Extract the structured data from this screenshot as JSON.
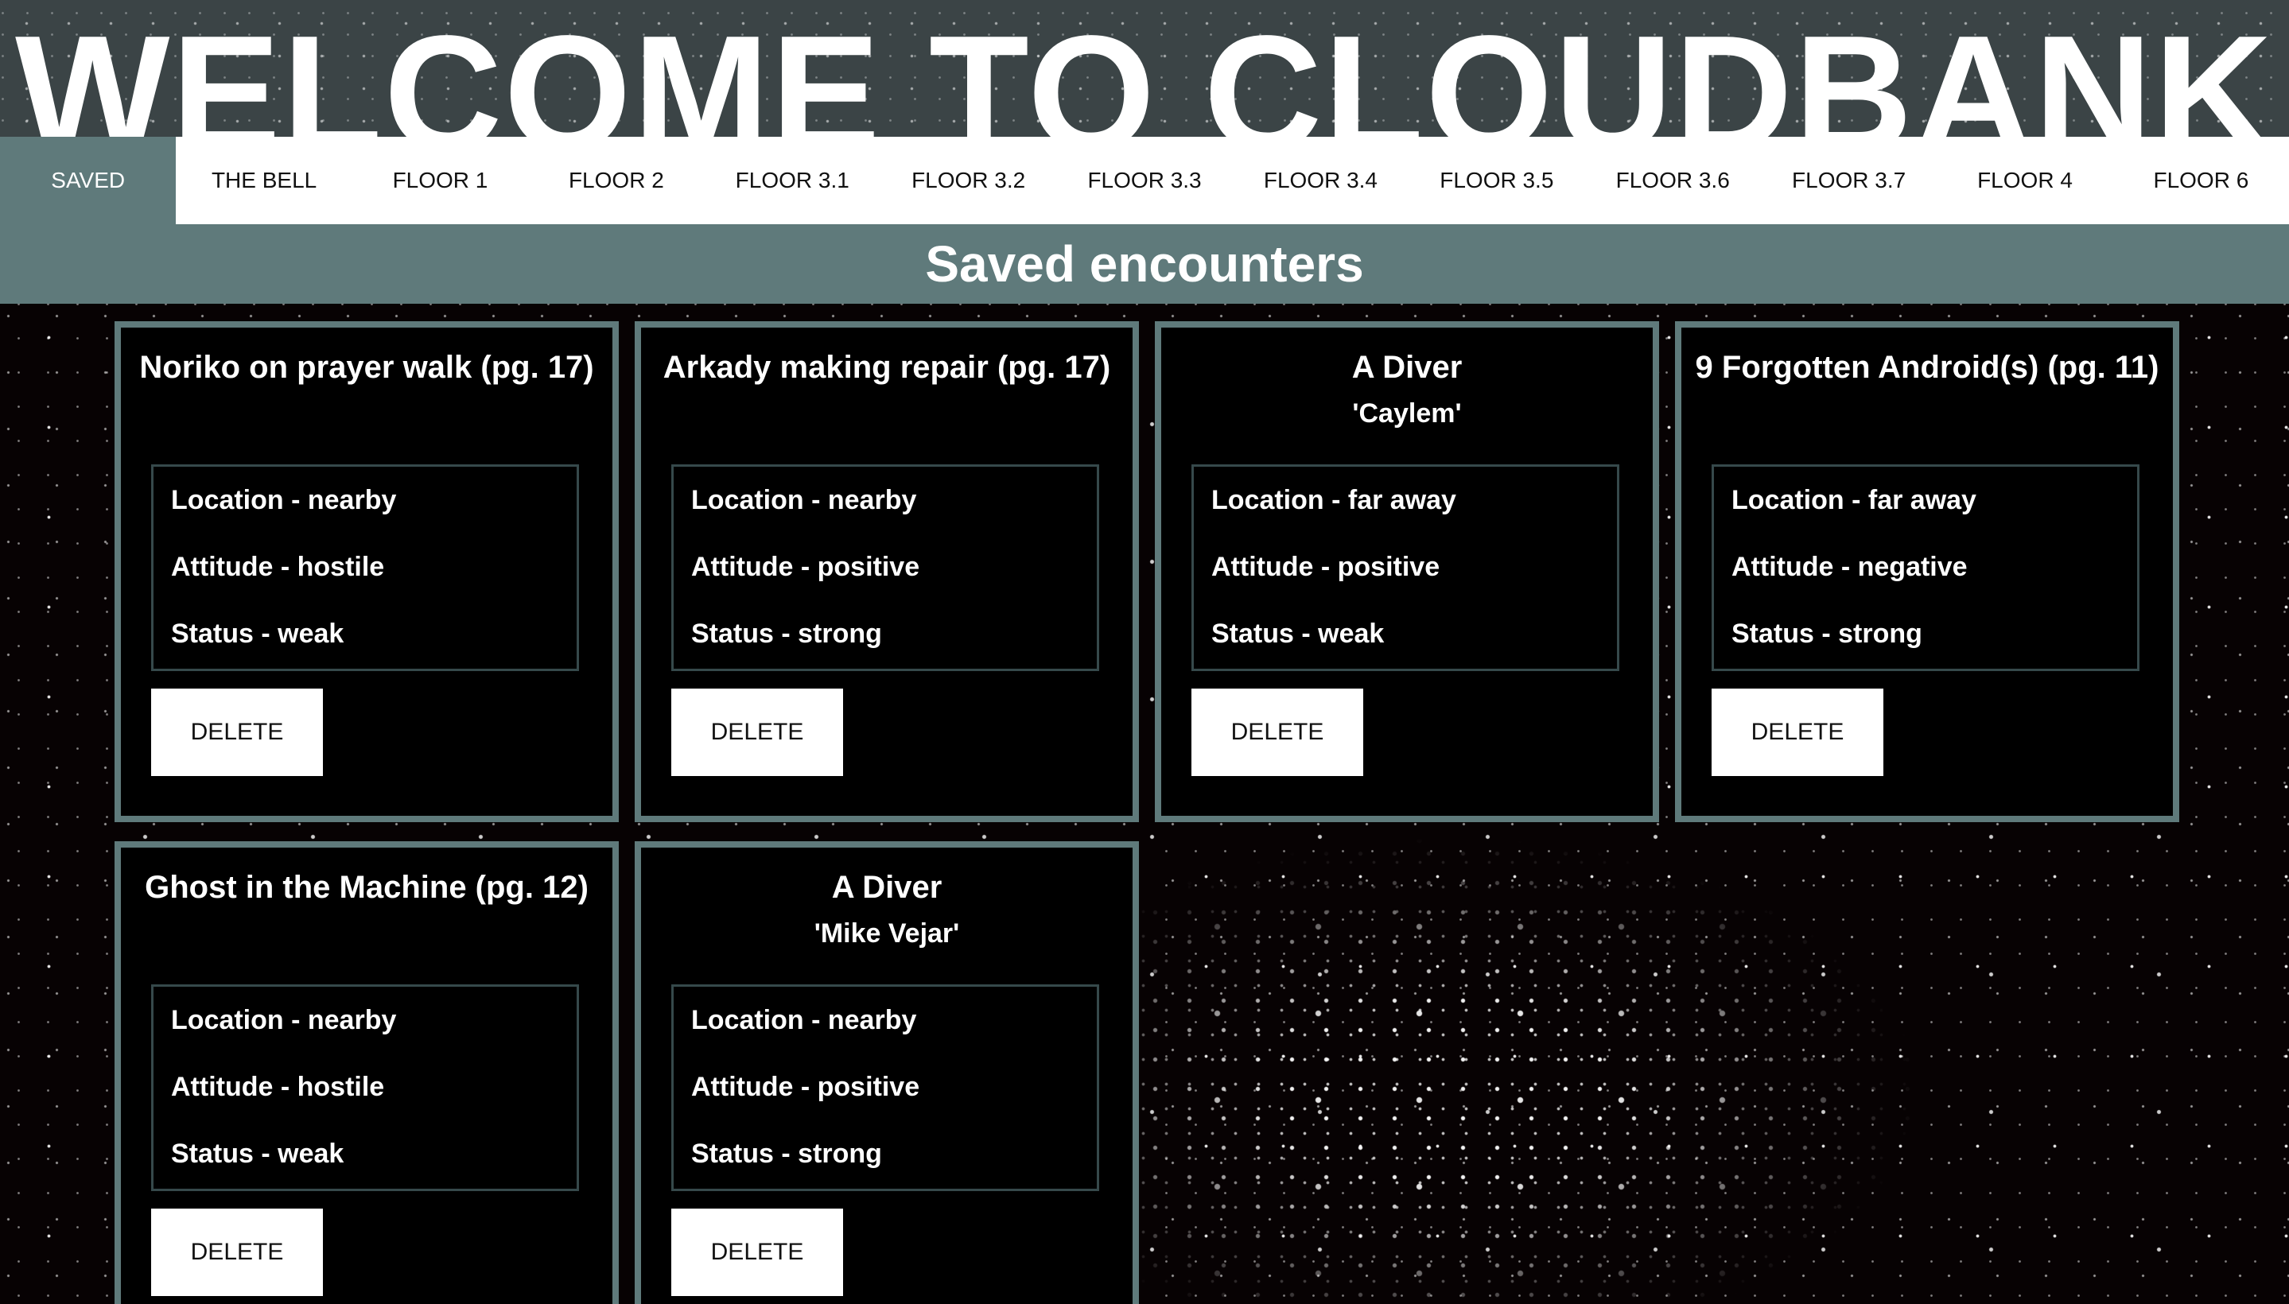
{
  "header": {
    "title": "WELCOME TO CLOUDBANK"
  },
  "nav": {
    "items": [
      {
        "label": "SAVED",
        "active": true
      },
      {
        "label": "THE BELL",
        "active": false
      },
      {
        "label": "FLOOR 1",
        "active": false
      },
      {
        "label": "FLOOR 2",
        "active": false
      },
      {
        "label": "FLOOR 3.1",
        "active": false
      },
      {
        "label": "FLOOR 3.2",
        "active": false
      },
      {
        "label": "FLOOR 3.3",
        "active": false
      },
      {
        "label": "FLOOR 3.4",
        "active": false
      },
      {
        "label": "FLOOR 3.5",
        "active": false
      },
      {
        "label": "FLOOR 3.6",
        "active": false
      },
      {
        "label": "FLOOR 3.7",
        "active": false
      },
      {
        "label": "FLOOR 4",
        "active": false
      },
      {
        "label": "FLOOR 6",
        "active": false
      }
    ]
  },
  "section": {
    "title": "Saved encounters"
  },
  "cards": [
    {
      "title": "Noriko on prayer walk (pg. 17)",
      "subtitle": "",
      "location": "Location - nearby",
      "attitude": "Attitude - hostile",
      "status": "Status - weak",
      "delete_label": "DELETE"
    },
    {
      "title": "Arkady making repair (pg. 17)",
      "subtitle": "",
      "location": "Location - nearby",
      "attitude": "Attitude - positive",
      "status": "Status - strong",
      "delete_label": "DELETE"
    },
    {
      "title": "A Diver",
      "subtitle": "'Caylem'",
      "location": "Location - far away",
      "attitude": "Attitude - positive",
      "status": "Status - weak",
      "delete_label": "DELETE"
    },
    {
      "title": "9 Forgotten Android(s) (pg. 11)",
      "subtitle": "",
      "location": "Location - far away",
      "attitude": "Attitude - negative",
      "status": "Status - strong",
      "delete_label": "DELETE"
    },
    {
      "title": "Ghost in the Machine (pg. 12)",
      "subtitle": "",
      "location": "Location - nearby",
      "attitude": "Attitude - hostile",
      "status": "Status - weak",
      "delete_label": "DELETE"
    },
    {
      "title": "A Diver",
      "subtitle": "'Mike Vejar'",
      "location": "Location - nearby",
      "attitude": "Attitude - positive",
      "status": "Status - strong",
      "delete_label": "DELETE"
    }
  ],
  "colors": {
    "accent": "#5f7a7b",
    "header_bg": "#3b4446",
    "page_bg": "#070203",
    "card_bg": "#000000",
    "info_border": "#36494b"
  }
}
